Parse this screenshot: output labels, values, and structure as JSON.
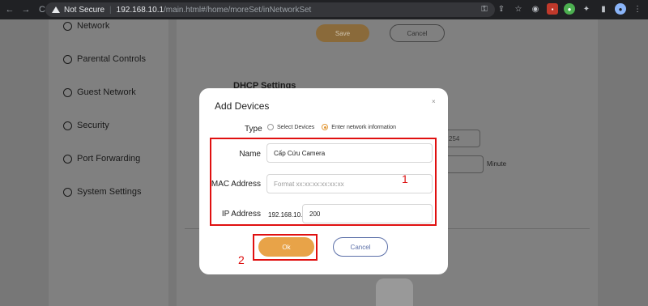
{
  "browser": {
    "security_label": "Not Secure",
    "separator": "|",
    "url_host": "192.168.10.1",
    "url_path": "/main.html#/home/moreSet/inNetworkSet",
    "nav": {
      "back": "←",
      "forward": "→",
      "reload": "C"
    },
    "toolbar_icons": {
      "key": "⚿",
      "share": "⇪",
      "star": "☆",
      "ext_a": "◉",
      "ext_b": "▪",
      "ext_c": "●",
      "puzzle": "✦",
      "sidepanel": "▮",
      "avatar": "●",
      "menu": "⋮"
    }
  },
  "sidebar": {
    "items": [
      {
        "label": "Network",
        "icon": "network-icon"
      },
      {
        "label": "Parental Controls",
        "icon": "parental-controls-icon"
      },
      {
        "label": "Guest Network",
        "icon": "guest-network-icon"
      },
      {
        "label": "Security",
        "icon": "security-icon"
      },
      {
        "label": "Port Forwarding",
        "icon": "port-forwarding-icon"
      },
      {
        "label": "System Settings",
        "icon": "system-settings-icon"
      }
    ]
  },
  "background": {
    "save_label": "Save",
    "cancel_label": "Cancel",
    "dhcp_heading": "DHCP Settings",
    "range_end_value": "254",
    "minute_label": "Minute"
  },
  "modal": {
    "title": "Add Devices",
    "close": "×",
    "type_label": "Type",
    "type_options": [
      "Select Devices",
      "Enter network information"
    ],
    "selected_option": "Enter network information",
    "name_label": "Name",
    "name_value": "Cấp Cứu Camera",
    "mac_label": "MAC Address",
    "mac_placeholder": "Format xx:xx:xx:xx:xx:xx",
    "ip_label": "IP Address",
    "ip_prefix": "192.168.10.",
    "ip_suffix_value": "200",
    "ok_label": "Ok",
    "cancel_label": "Cancel"
  },
  "annotations": {
    "box1_number": "1",
    "box2_number": "2"
  },
  "colors": {
    "accent": "#e8a348",
    "annotation_red": "#e01010",
    "cancel_outline": "#5b6fa8"
  }
}
